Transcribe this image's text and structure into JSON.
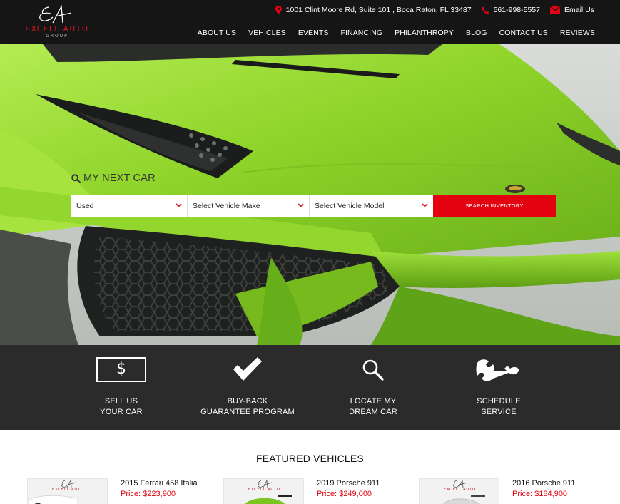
{
  "header": {
    "logo_brand": "EXCELL AUTO",
    "logo_sub": "GROUP",
    "address": "1001 Clint Moore Rd, Suite 101 , Boca Raton, FL 33487",
    "phone": "561-998-5557",
    "email_label": "Email Us",
    "nav": [
      "ABOUT US",
      "VEHICLES",
      "EVENTS",
      "FINANCING",
      "PHILANTHROPY",
      "BLOG",
      "CONTACT US",
      "REVIEWS"
    ]
  },
  "hero": {
    "search_title": "MY NEXT CAR",
    "condition_value": "Used",
    "make_placeholder": "Select Vehicle Make",
    "model_placeholder": "Select Vehicle Model",
    "search_button": "SEARCH INVENTORY"
  },
  "services": [
    {
      "line1": "SELL US",
      "line2": "YOUR CAR",
      "icon": "dollar-icon",
      "symbol": "$"
    },
    {
      "line1": "BUY-BACK",
      "line2": "GUARANTEE PROGRAM",
      "icon": "checkmark-icon"
    },
    {
      "line1": "LOCATE MY",
      "line2": "DREAM CAR",
      "icon": "search-icon"
    },
    {
      "line1": "SCHEDULE",
      "line2": "SERVICE",
      "icon": "wrench-icon"
    }
  ],
  "featured": {
    "title": "FEATURED VEHICLES",
    "vehicles": [
      {
        "name": "2015 Ferrari 458 Italia",
        "price": "Price: $223,900"
      },
      {
        "name": "2019 Porsche 911",
        "price": "Price: $249,000"
      },
      {
        "name": "2016 Porsche 911",
        "price": "Price: $184,900"
      }
    ]
  },
  "colors": {
    "accent_red": "#e3020f",
    "header_bg": "#151515",
    "services_bg": "#2b2b2b",
    "car_green": "#8fd42a"
  }
}
